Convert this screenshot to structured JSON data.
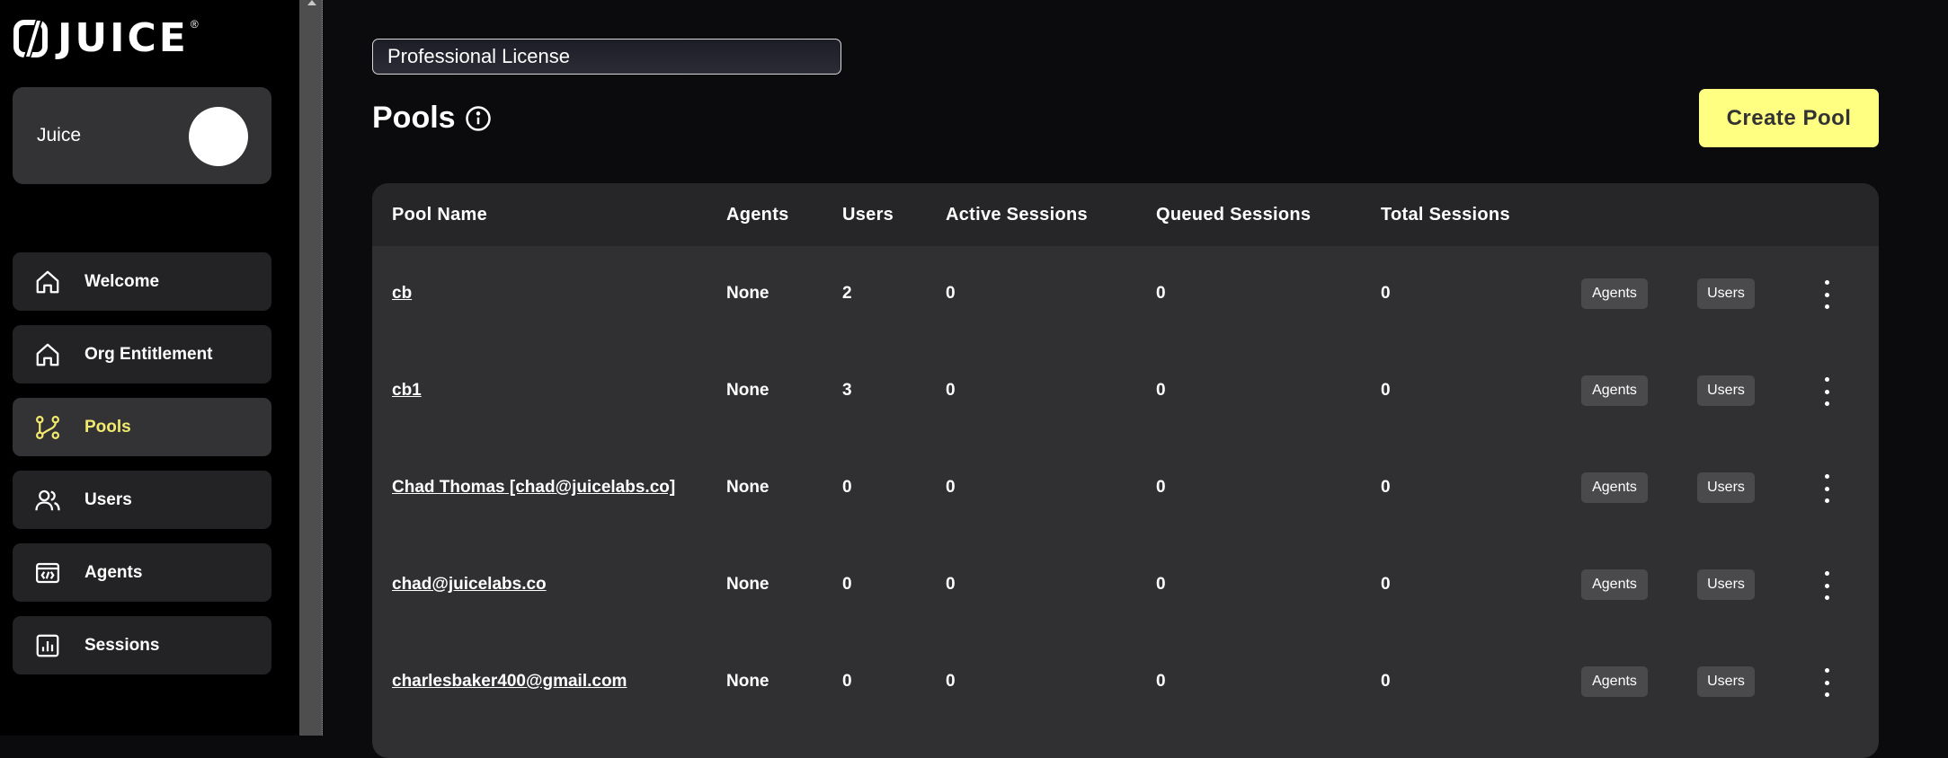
{
  "brand": {
    "name": "JUICE",
    "reg": "®"
  },
  "org": {
    "name": "Juice"
  },
  "sidebar": {
    "items": [
      {
        "label": "Welcome",
        "icon": "home-icon",
        "active": false
      },
      {
        "label": "Org Entitlement",
        "icon": "home-icon",
        "active": false
      },
      {
        "label": "Pools",
        "icon": "pools-icon",
        "active": true
      },
      {
        "label": "Users",
        "icon": "users-icon",
        "active": false
      },
      {
        "label": "Agents",
        "icon": "agents-icon",
        "active": false
      },
      {
        "label": "Sessions",
        "icon": "sessions-icon",
        "active": false
      }
    ]
  },
  "license": {
    "selected": "Professional License"
  },
  "page": {
    "title": "Pools",
    "create_label": "Create Pool"
  },
  "table": {
    "headers": [
      "Pool Name",
      "Agents",
      "Users",
      "Active Sessions",
      "Queued Sessions",
      "Total Sessions"
    ],
    "agents_chip": "Agents",
    "users_chip": "Users",
    "rows": [
      {
        "name": "cb",
        "agents": "None",
        "users": "2",
        "active": "0",
        "queued": "0",
        "total": "0"
      },
      {
        "name": "cb1",
        "agents": "None",
        "users": "3",
        "active": "0",
        "queued": "0",
        "total": "0"
      },
      {
        "name": "Chad Thomas [chad@juicelabs.co]",
        "agents": "None",
        "users": "0",
        "active": "0",
        "queued": "0",
        "total": "0"
      },
      {
        "name": "chad@juicelabs.co",
        "agents": "None",
        "users": "0",
        "active": "0",
        "queued": "0",
        "total": "0"
      },
      {
        "name": "charlesbaker400@gmail.com",
        "agents": "None",
        "users": "0",
        "active": "0",
        "queued": "0",
        "total": "0"
      }
    ]
  },
  "colors": {
    "accent": "#f2ea6e",
    "button": "#ffff82",
    "panel": "#303033"
  }
}
